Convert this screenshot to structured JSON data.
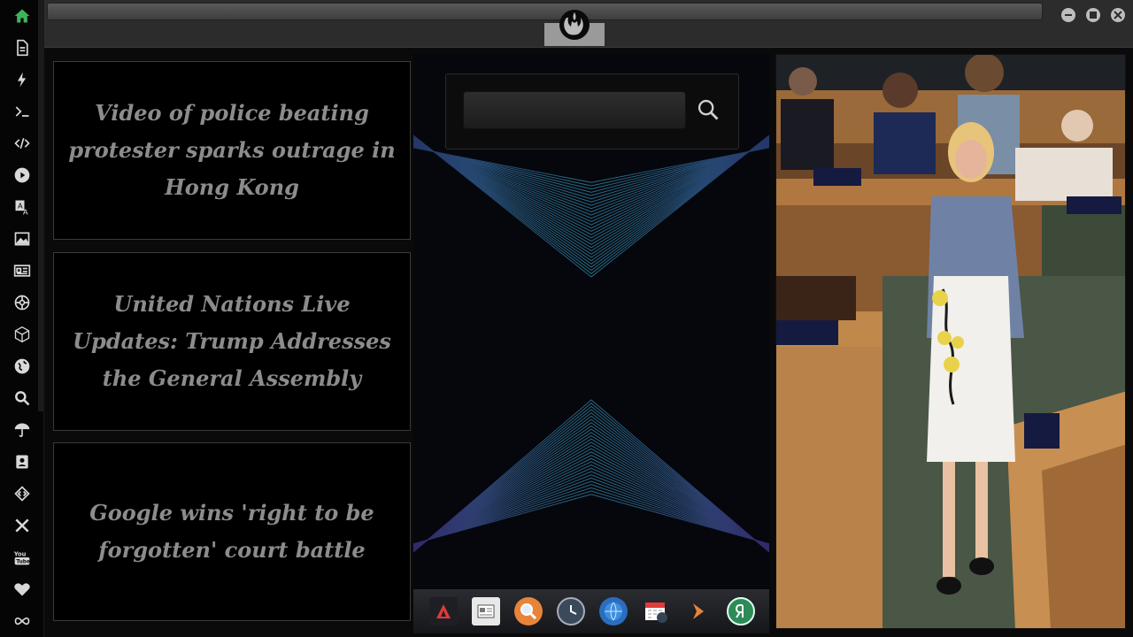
{
  "sidebar": {
    "icons": [
      "home-icon",
      "document-icon",
      "bolt-icon",
      "terminal-icon",
      "code-icon",
      "play-icon",
      "translate-icon",
      "image-icon",
      "news-icon",
      "settings-wheel-icon",
      "cube-icon",
      "globe-icon",
      "search-icon",
      "umbrella-icon",
      "contacts-icon",
      "diamond-code-icon",
      "tools-icon",
      "youtube-icon",
      "heart-icon",
      "infinity-icon"
    ]
  },
  "news": {
    "items": [
      {
        "title": "Video of police beating protester sparks outrage in Hong Kong"
      },
      {
        "title": "United Nations Live Updates: Trump Addresses the General Assembly"
      },
      {
        "title": "Google wins 'right to be forgotten' court battle"
      }
    ]
  },
  "search": {
    "value": "",
    "placeholder": ""
  },
  "dock": {
    "items": [
      "app-a-icon",
      "news-reader-icon",
      "magnifier-app-icon",
      "clock-app-icon",
      "browser-globe-icon",
      "calendar-app-icon",
      "play-arrow-icon",
      "yandex-icon"
    ]
  },
  "colors": {
    "accent_green": "#3fb35a",
    "news_text": "#8c8c8c",
    "line_blue": "#2f4f8a"
  }
}
